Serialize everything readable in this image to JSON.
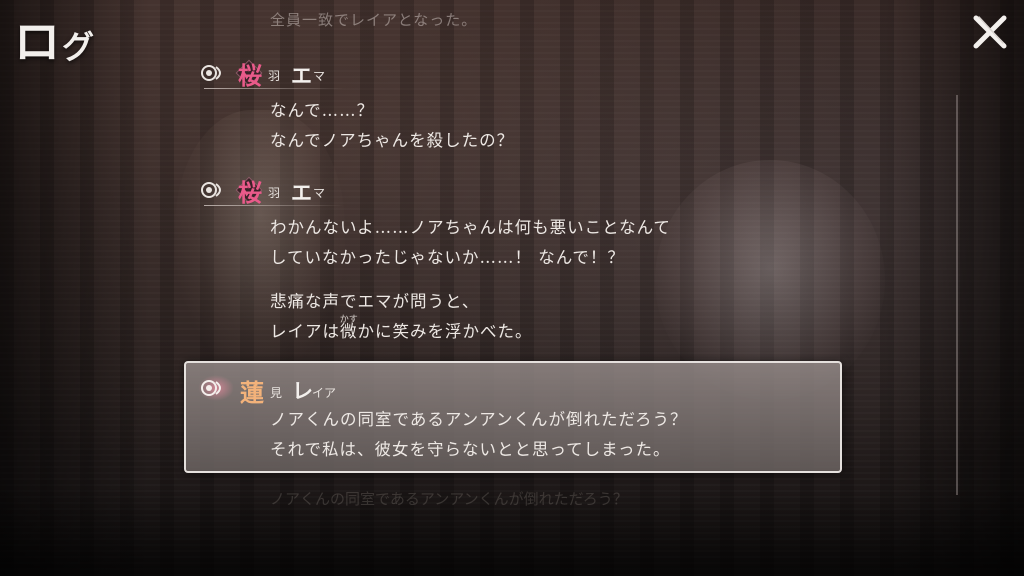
{
  "header": {
    "title_main": "ロ",
    "title_small": "グ",
    "close_icon": "close-x-icon"
  },
  "faded_top_line": "全員一致でレイアとなった。",
  "faded_bottom_line": "ノアくんの同室であるアンアンくんが倒れただろう？",
  "colors": {
    "ema_name": "#e95a8a",
    "reia_name": "#f3b27a",
    "selected_border": "#f0ece8"
  },
  "entries": [
    {
      "voice_icon": "voice-replay-icon",
      "name": {
        "kanji1": "桜",
        "kanji1_small": "羽",
        "kana1": "エ",
        "kana1_small": "マ"
      },
      "lines": [
        "なんで……？",
        "なんでノアちゃんを殺したの？"
      ]
    },
    {
      "voice_icon": "voice-replay-icon",
      "name": {
        "kanji1": "桜",
        "kanji1_small": "羽",
        "kana1": "エ",
        "kana1_small": "マ"
      },
      "lines": [
        "わかんないよ……ノアちゃんは何も悪いことなんて",
        "していなかったじゃないか……！ なんで！？"
      ],
      "narration": {
        "line1": "悲痛な声でエマが問うと、",
        "line2_pre": "レイアは",
        "ruby_base": "微",
        "ruby_reading": "かす",
        "line2_post": "かに笑みを浮かべた。"
      }
    },
    {
      "voice_icon": "voice-replay-icon",
      "selected": true,
      "name": {
        "kanji1": "蓮",
        "kanji1_small": "見",
        "kana1": "レ",
        "kana1_small": "イア"
      },
      "lines": [
        "ノアくんの同室であるアンアンくんが倒れただろう？",
        "それで私は、彼女を守らないとと思ってしまった。"
      ]
    }
  ]
}
